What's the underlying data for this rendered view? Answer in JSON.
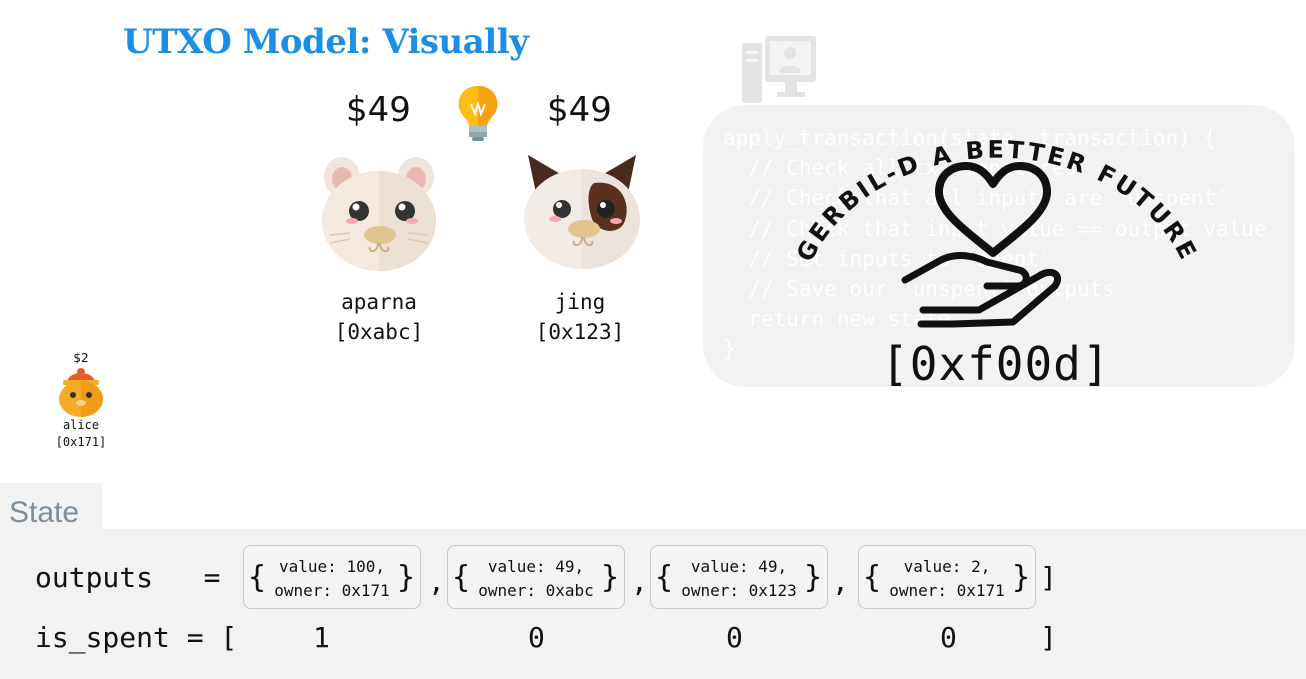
{
  "title": "UTXO Model: Visually",
  "users": {
    "aparna": {
      "balance": "$49",
      "name": "aparna",
      "address": "[0xabc]"
    },
    "jing": {
      "balance": "$49",
      "name": "jing",
      "address": "[0x123]"
    },
    "alice": {
      "balance": "$2",
      "name": "alice",
      "address": "[0x171]"
    }
  },
  "contract": {
    "code_lines": [
      "apply_transaction(state, transaction) {",
      "  // Check all tx signatures",
      "  // Check that all inputs are `unspent`",
      "  // Check that input value == output value",
      "  // Set inputs to `spent`",
      "  // Save our `unspent` outputs",
      "  return new state",
      "}"
    ],
    "logo_text": "GERBIL-D A BETTER FUTURE",
    "address": "[0xf00d]"
  },
  "state": {
    "label": "State",
    "outputs_label": "outputs   = [",
    "is_spent_label": "is_spent = [",
    "close_bracket": "]",
    "separator": ",",
    "outputs": [
      {
        "value": "value: 100,",
        "owner": "owner: 0x171"
      },
      {
        "value": "value: 49,",
        "owner": "owner: 0xabc"
      },
      {
        "value": "value: 49,",
        "owner": "owner: 0x123"
      },
      {
        "value": "value: 2,",
        "owner": "owner: 0x171"
      }
    ],
    "is_spent": [
      "1",
      "0",
      "0",
      "0"
    ]
  },
  "colors": {
    "title": "#1a8fe3",
    "panel": "#f2f2f2",
    "state_label": "#7b8f9d"
  }
}
